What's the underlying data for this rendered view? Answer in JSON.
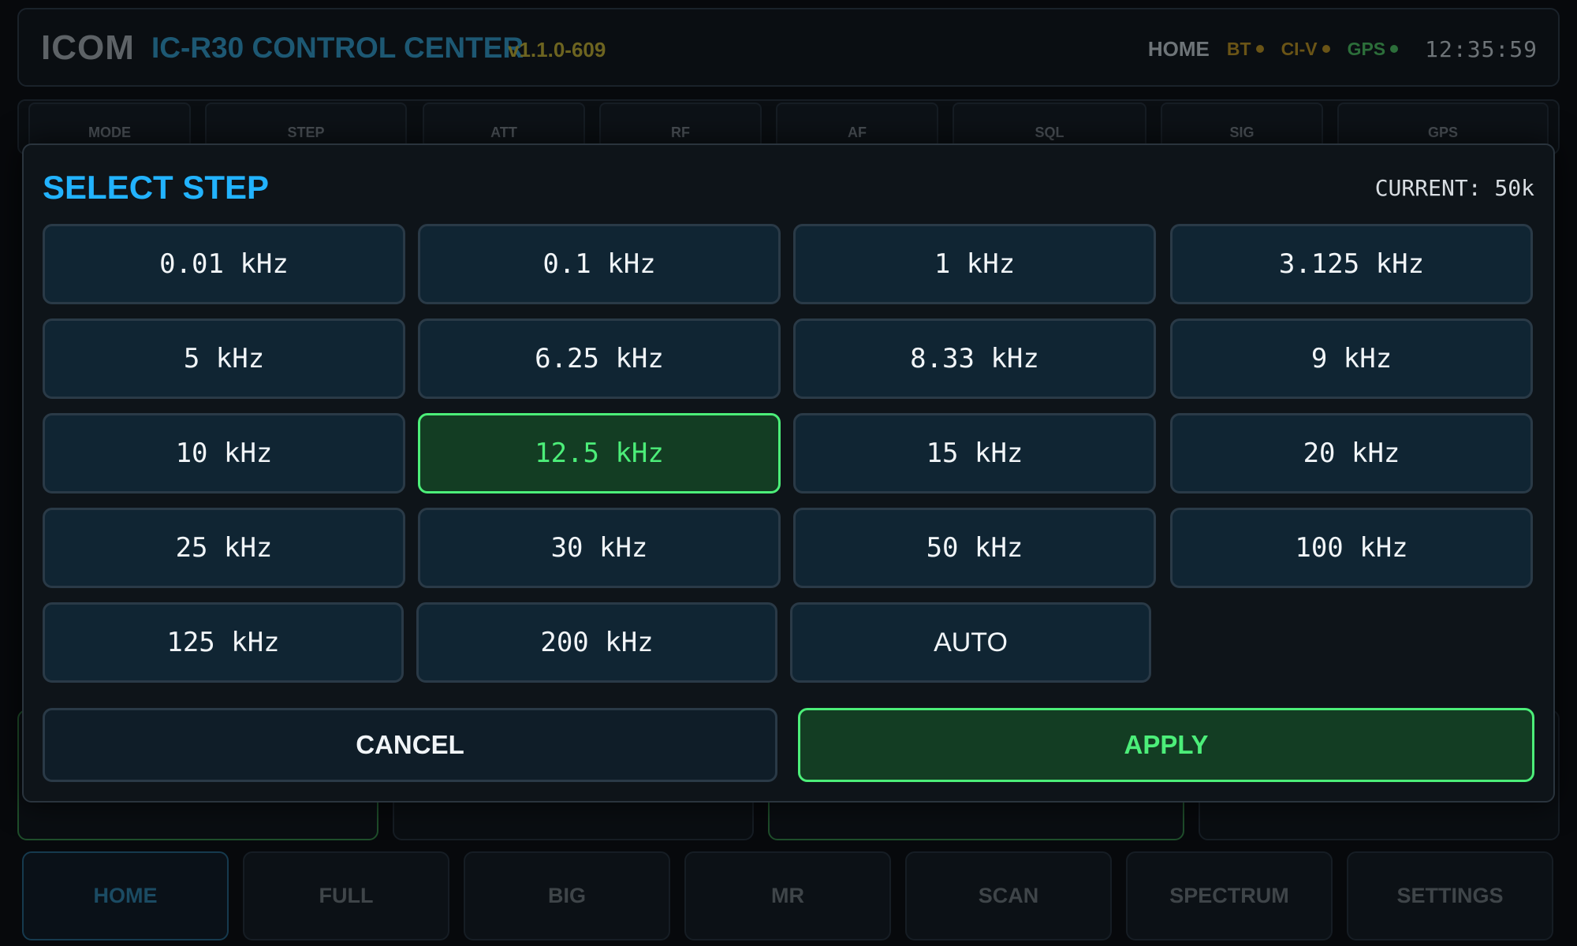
{
  "header": {
    "brand": "ICOM",
    "title": "IC-R30 CONTROL CENTER",
    "version": "v1.1.0-609",
    "home": "HOME",
    "status": [
      {
        "label": "BT",
        "color": "#6a5416"
      },
      {
        "label": "CI-V",
        "color": "#6a5416"
      },
      {
        "label": "GPS",
        "color": "#2c6e3a"
      }
    ],
    "clock": "12:35:59"
  },
  "param_bar": {
    "items": [
      "MODE",
      "STEP",
      "ATT",
      "RF",
      "AF",
      "SQL",
      "SIG",
      "GPS"
    ]
  },
  "dialog": {
    "title": "SELECT STEP",
    "current": "CURRENT: 50k",
    "steps": [
      "0.01 kHz",
      "0.1 kHz",
      "1 kHz",
      "3.125 kHz",
      "5 kHz",
      "6.25 kHz",
      "8.33 kHz",
      "9 kHz",
      "10 kHz",
      "12.5 kHz",
      "15 kHz",
      "20 kHz",
      "25 kHz",
      "30 kHz",
      "50 kHz",
      "100 kHz",
      "125 kHz",
      "200 kHz",
      "AUTO"
    ],
    "selected": "12.5 kHz",
    "cancel_label": "CANCEL",
    "apply_label": "APPLY"
  },
  "nav": {
    "items": [
      "HOME",
      "FULL",
      "BIG",
      "MR",
      "SCAN",
      "SPECTRUM",
      "SETTINGS"
    ],
    "active": "HOME"
  },
  "colors": {
    "accent_blue": "#22b3ff",
    "accent_green": "#4cee79",
    "button_bg": "#102533"
  }
}
